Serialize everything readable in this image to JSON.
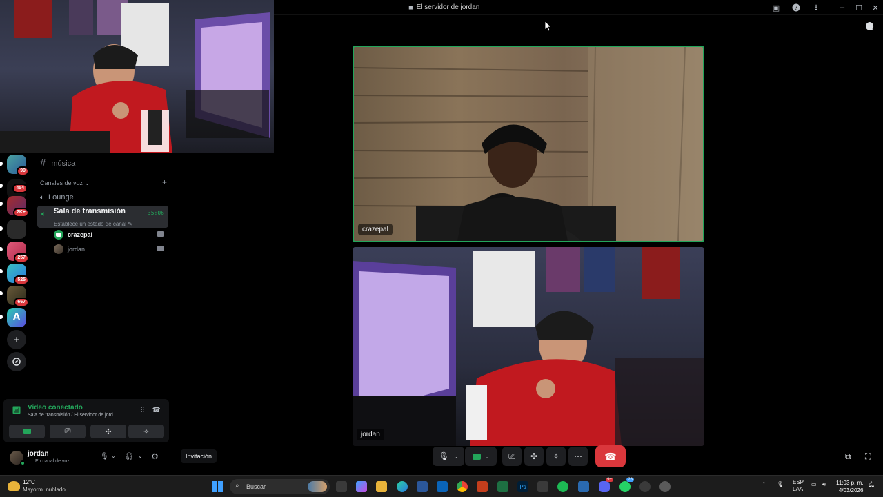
{
  "window": {
    "title": "El servidor de jordan",
    "colors": {
      "background": "#000000",
      "accent_green": "#23a55a",
      "danger": "#da373c"
    }
  },
  "channel_sidebar": {
    "text_channel": "música",
    "voice_category": "Canales de voz",
    "voice_channels": [
      {
        "name": "Lounge"
      },
      {
        "name": "Sala de transmisión",
        "status": "Establece un estado de canal",
        "timer": "35:06",
        "active": true
      }
    ],
    "members": [
      {
        "name": "crazepal"
      },
      {
        "name": "jordan"
      }
    ]
  },
  "servers": {
    "badges": [
      "99",
      "454",
      "2K+",
      "257",
      "525",
      "667"
    ]
  },
  "voice_panel": {
    "status": "Video conectado",
    "location": "Sala de transmisión / El servidor de jord..."
  },
  "user": {
    "name": "jordan",
    "status": "En canal de voz"
  },
  "stage": {
    "tiles": [
      {
        "label": "crazepal",
        "speaking": true
      },
      {
        "label": "jordan",
        "speaking": false
      }
    ],
    "invite_label": "Invitación"
  },
  "taskbar": {
    "weather_temp": "12°C",
    "weather_desc": "Mayorm. nublado",
    "search_label": "Buscar",
    "chat_badge": "9+",
    "whatsapp_badge": "28",
    "lang_line1": "ESP",
    "lang_line2": "LAA",
    "time": "11:03 p. m.",
    "date": "4/03/2026"
  }
}
